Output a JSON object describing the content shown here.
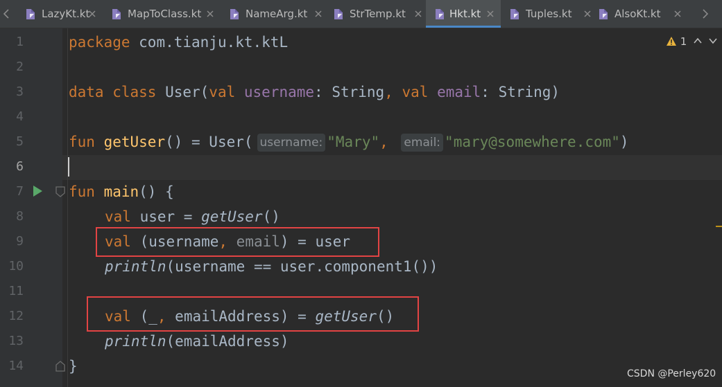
{
  "tabs": [
    {
      "label": "LazyKt.kt",
      "active": false
    },
    {
      "label": "MapToClass.kt",
      "active": false
    },
    {
      "label": "NameArg.kt",
      "active": false
    },
    {
      "label": "StrTemp.kt",
      "active": false
    },
    {
      "label": "Hkt.kt",
      "active": true
    },
    {
      "label": "Tuples.kt",
      "active": false
    },
    {
      "label": "AlsoKt.kt",
      "active": false
    }
  ],
  "line_numbers": [
    "1",
    "2",
    "3",
    "4",
    "5",
    "6",
    "7",
    "8",
    "9",
    "10",
    "11",
    "12",
    "13",
    "14"
  ],
  "code": {
    "l1": {
      "kw": "package",
      "rest": " com.tianju.kt.ktL"
    },
    "l3": {
      "kw1": "data class",
      "cls": " User(",
      "kw2": "val",
      "p1": " username",
      "t1": ": String",
      "comma": ", ",
      "kw3": "val",
      "p2": " email",
      "t2": ": String)"
    },
    "l5": {
      "kw": "fun",
      "fn": " getUser",
      "mid": "() = User(",
      "hint1": "username:",
      "s1": "\"Mary\"",
      "comma": ", ",
      "hint2": "email:",
      "s2": "\"mary@somewhere.com\"",
      "end": ")"
    },
    "l7": {
      "kw": "fun",
      "fn": " main",
      "rest": "() {"
    },
    "l8": {
      "kw": "val",
      "mid": " user = ",
      "call": "getUser",
      "end": "()"
    },
    "l9": {
      "kw": "val",
      "a": " (username",
      "b": ",",
      "c": " email",
      "d": ") = user"
    },
    "l10": {
      "call": "println",
      "rest": "(username == user.component1())"
    },
    "l12": {
      "kw": "val",
      "a": " (_",
      "b": ",",
      "c": " emailAddress) = ",
      "call": "getUser",
      "end": "()"
    },
    "l13": {
      "call": "println",
      "rest": "(emailAddress)"
    },
    "l14": {
      "brace": "}"
    }
  },
  "inspection": {
    "count": "1"
  },
  "watermark": "CSDN @Perley620",
  "colors": {
    "keyword": "#cc7832",
    "function": "#ffc66d",
    "string": "#6a8759",
    "param": "#9876aa",
    "text": "#a9b7c6",
    "highlight_box": "#e34444",
    "active_tab_underline": "#4a88c7"
  },
  "icons": {
    "tab": "kotlin-file-icon",
    "close": "close-icon",
    "run": "run-icon",
    "warning": "warning-icon",
    "nav": "chevron-up-icon"
  }
}
